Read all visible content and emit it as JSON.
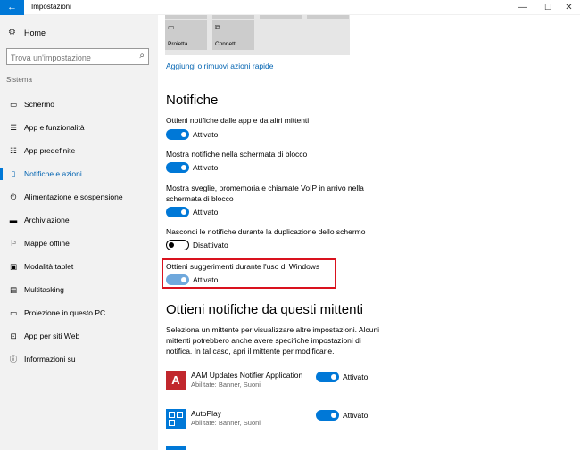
{
  "window": {
    "title": "Impostazioni",
    "back_icon": "←",
    "minimize_icon": "—",
    "maximize_icon": "☐",
    "close_icon": "✕",
    "accent": "#0078d7"
  },
  "sidebar": {
    "home_label": "Home",
    "search_placeholder": "Trova un'impostazione",
    "section": "Sistema",
    "items": [
      {
        "label": "Schermo",
        "icon": "monitor-icon",
        "glyph": "▭"
      },
      {
        "label": "App e funzionalità",
        "icon": "apps-list-icon",
        "glyph": "☰"
      },
      {
        "label": "App predefinite",
        "icon": "default-apps-icon",
        "glyph": "☷"
      },
      {
        "label": "Notifiche e azioni",
        "icon": "notifications-icon",
        "glyph": "▯",
        "active": true
      },
      {
        "label": "Alimentazione e sospensione",
        "icon": "power-icon",
        "glyph": "⏻"
      },
      {
        "label": "Archiviazione",
        "icon": "storage-icon",
        "glyph": "▬"
      },
      {
        "label": "Mappe offline",
        "icon": "map-icon",
        "glyph": "⚐"
      },
      {
        "label": "Modalità tablet",
        "icon": "tablet-icon",
        "glyph": "▣"
      },
      {
        "label": "Multitasking",
        "icon": "multitasking-icon",
        "glyph": "▤"
      },
      {
        "label": "Proiezione in questo PC",
        "icon": "projection-icon",
        "glyph": "▭"
      },
      {
        "label": "App per siti Web",
        "icon": "web-apps-icon",
        "glyph": "⊡"
      },
      {
        "label": "Informazioni su",
        "icon": "info-icon",
        "glyph": "ⓘ"
      }
    ]
  },
  "quick_actions": {
    "tiles": [
      {
        "label": "Proietta",
        "icon": "project-icon",
        "glyph": "▭"
      },
      {
        "label": "Connetti",
        "icon": "connect-icon",
        "glyph": "⧉"
      }
    ],
    "link": "Aggiungi o rimuovi azioni rapide"
  },
  "notifications": {
    "heading": "Notifiche",
    "settings": [
      {
        "text": "Ottieni notifiche dalle app e da altri mittenti",
        "state": "Attivato"
      },
      {
        "text": "Mostra notifiche nella schermata di blocco",
        "state": "Attivato"
      },
      {
        "text": "Mostra sveglie, promemoria e chiamate VoIP in arrivo nella schermata di blocco",
        "state": "Attivato"
      },
      {
        "text": "Nascondi le notifiche durante la duplicazione dello schermo",
        "state": "Disattivato"
      },
      {
        "text": "Ottieni suggerimenti durante l'uso di Windows",
        "state": "Attivato"
      }
    ]
  },
  "senders": {
    "heading": "Ottieni notifiche da questi mittenti",
    "description": "Seleziona un mittente per visualizzare altre impostazioni. Alcuni mittenti potrebbero anche avere specifiche impostazioni di notifica. In tal caso, apri il mittente per modificarle.",
    "apps": [
      {
        "name": "AAM Updates Notifier Application",
        "sub": "Abilitate: Banner, Suoni",
        "state": "Attivato",
        "icon": "adobe-icon"
      },
      {
        "name": "AutoPlay",
        "sub": "Abilitate: Banner, Suoni",
        "state": "Attivato",
        "icon": "autoplay-icon"
      }
    ]
  },
  "colors": {
    "toggle_on": "#0078d7",
    "highlight_border": "#d9121e",
    "link": "#0063b1",
    "sidebar_bg": "#f2f2f2"
  }
}
